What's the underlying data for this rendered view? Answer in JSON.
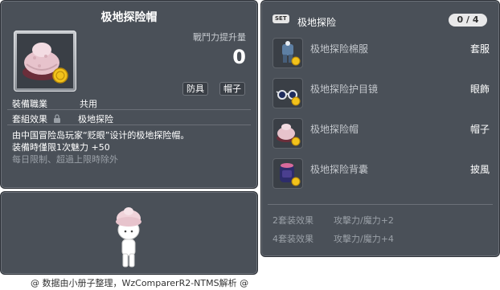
{
  "item_id": "01005109",
  "item": {
    "name": "极地探险帽",
    "power_label": "戰鬥力提升量",
    "power_value": "0",
    "tags": [
      "防具",
      "帽子"
    ],
    "job_label": "裝備職業",
    "job_value": "共用",
    "set_label": "套組效果",
    "set_value": "极地探险",
    "description_line1": "由中国冒险岛玩家“贬眼”设计的极地探险帽。",
    "description_line2": "装備時僅限1次魅力 +50",
    "description_line3": "每日限制、超過上限時除外"
  },
  "set": {
    "badge": "SET",
    "name": "极地探险",
    "count": "0 / 4",
    "items": [
      {
        "name": "极地探险棉服",
        "type": "套服",
        "icon": "coat-icon"
      },
      {
        "name": "极地探险护目镜",
        "type": "眼飾",
        "icon": "goggles-icon"
      },
      {
        "name": "极地探险帽",
        "type": "帽子",
        "icon": "hat-icon"
      },
      {
        "name": "极地探险背囊",
        "type": "披風",
        "icon": "backpack-icon"
      }
    ],
    "bonuses": [
      {
        "label": "2套装效果",
        "effect": "攻擊力/魔力+2"
      },
      {
        "label": "4套装效果",
        "effect": "攻擊力/魔力+4"
      }
    ]
  },
  "footer": "@ 数据由小册子整理，WzComparerR2-NTMS解析 @",
  "colors": {
    "panel_bg": "#4a5058",
    "muted_text": "#9aa0a7",
    "hat_pink": "#e7c3cc",
    "medal_gold": "#f2c21b"
  }
}
